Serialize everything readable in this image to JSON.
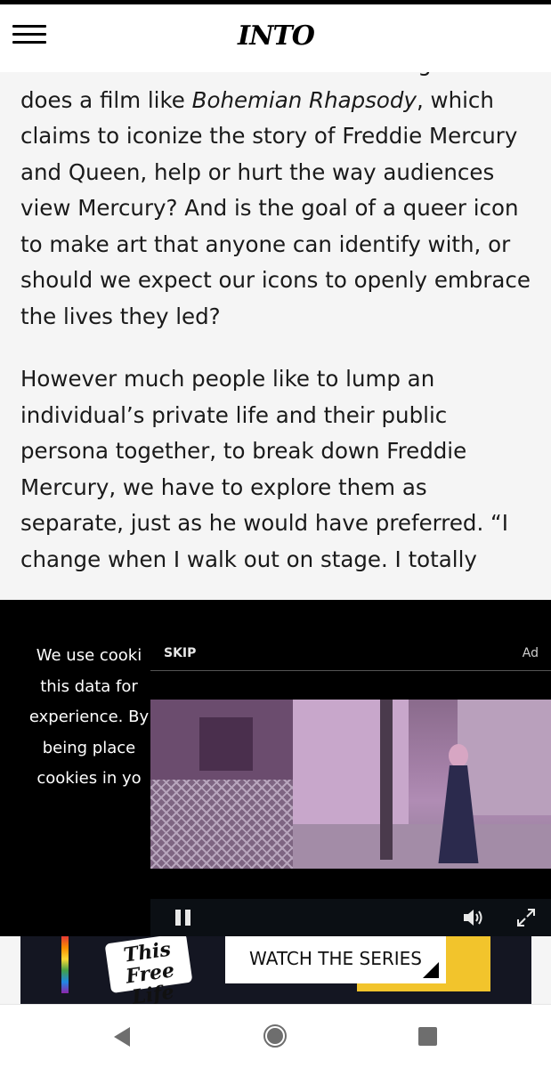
{
  "header": {
    "logo_text": "INTO",
    "menu_icon": "hamburger-menu-icon"
  },
  "article": {
    "paragraph1": {
      "part1": "Rami Malek said before the screening. But does a film like ",
      "italic": "Bohemian Rhapsody",
      "part2": ", which claims to iconize the story of Freddie Mercury and Queen, help or hurt the way audiences view Mercury? And is the goal of a queer icon to make art that anyone can identify with, or should we expect our icons to openly embrace the lives they led?"
    },
    "paragraph2": "However much people like to lump an individual’s private life and their public persona together, to break down Freddie Mercury, we have to explore them as separate, just as he would have preferred. “I change when I walk out on stage. I totally"
  },
  "cookie_notice": {
    "lines": [
      "We use cooki",
      "this data for",
      "experience. By",
      "being place",
      "cookies in yo"
    ]
  },
  "ad": {
    "skip_label": "SKIP",
    "ad_label": "Ad",
    "controls": {
      "pause_icon": "pause-icon",
      "volume_icon": "volume-icon",
      "fullscreen_icon": "fullscreen-icon"
    }
  },
  "banner": {
    "logo_text": "This Free Life",
    "cta_label": "WATCH THE SERIES"
  },
  "nav": {
    "back_icon": "back-triangle-icon",
    "home_icon": "home-circle-icon",
    "recent_icon": "recent-apps-square-icon"
  }
}
